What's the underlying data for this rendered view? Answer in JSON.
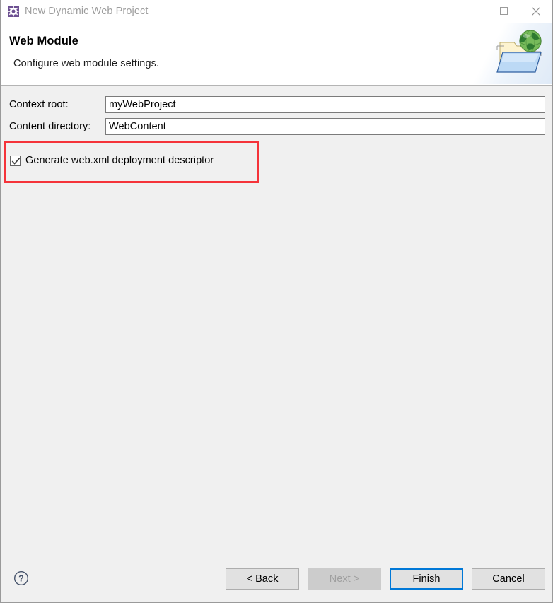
{
  "window": {
    "title": "New Dynamic Web Project",
    "icon": "eclipse-gear-icon",
    "controls": {
      "minimize": "minimize-icon",
      "maximize": "maximize-icon",
      "close": "close-icon"
    }
  },
  "header": {
    "title": "Web Module",
    "description": "Configure web module settings.",
    "banner_icon": "web-folder-globe-icon"
  },
  "form": {
    "fields": [
      {
        "label": "Context root:",
        "value": "myWebProject",
        "placeholder": ""
      },
      {
        "label": "Content directory:",
        "value": "WebContent",
        "placeholder": ""
      }
    ],
    "checkbox": {
      "label": "Generate web.xml deployment descriptor",
      "checked": true
    },
    "annotation": {
      "type": "highlight-rectangle",
      "color": "#f5333a"
    }
  },
  "footer": {
    "help_icon": "help-question-icon",
    "buttons": [
      {
        "label": "< Back",
        "state": "enabled"
      },
      {
        "label": "Next >",
        "state": "disabled"
      },
      {
        "label": "Finish",
        "state": "default"
      },
      {
        "label": "Cancel",
        "state": "enabled"
      }
    ]
  },
  "colors": {
    "accent": "#0078d7",
    "annotation": "#f5333a",
    "dialog_background": "#f0f0f0",
    "header_background": "#ffffff",
    "icon_purple": "#6c4f91"
  }
}
